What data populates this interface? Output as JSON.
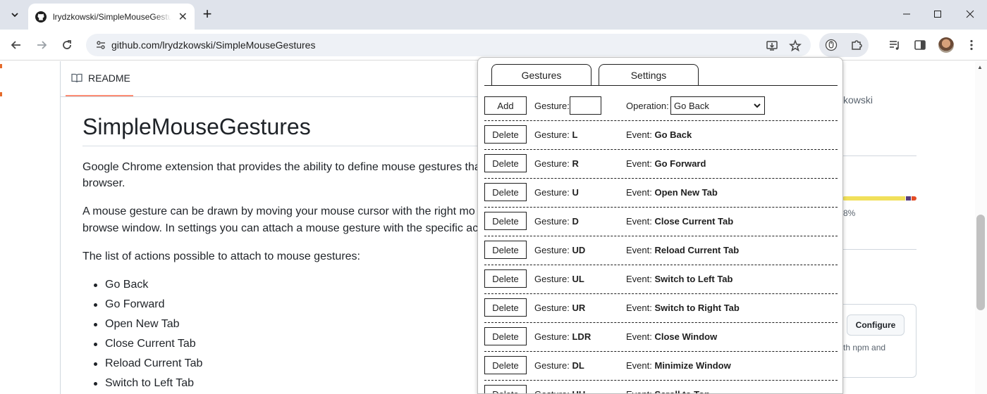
{
  "browser": {
    "tab_title": "lrydzkowski/SimpleMouseGestures",
    "url": "github.com/lrydzkowski/SimpleMouseGestures"
  },
  "readme": {
    "tab_label": "README",
    "title": "SimpleMouseGestures",
    "paragraphs": [
      "Google Chrome extension that provides the ability to define mouse gestures tha",
      "browser.",
      "A mouse gesture can be drawn by moving your mouse cursor with the right mo",
      "browse window. In settings you can attach a mouse gesture with the specific act",
      "The list of actions possible to attach to mouse gestures:"
    ],
    "actions": [
      "Go Back",
      "Go Forward",
      "Open New Tab",
      "Close Current Tab",
      "Reload Current Tab",
      "Switch to Left Tab"
    ]
  },
  "sidebar": {
    "owner_fragment": "kowski",
    "lang_percent_fragment": "8%",
    "config_button": "Configure",
    "config_text_fragment": "th npm and",
    "lang_colors": [
      "#f1e05a",
      "#563d7c",
      "#e34c26"
    ]
  },
  "popup": {
    "tabs": [
      "Gestures",
      "Settings"
    ],
    "add_label": "Add",
    "gesture_label": "Gesture:",
    "operation_label": "Operation:",
    "operation_selected": "Go Back",
    "event_label": "Event:",
    "delete_label": "Delete",
    "rows": [
      {
        "gesture": "L",
        "event": "Go Back"
      },
      {
        "gesture": "R",
        "event": "Go Forward"
      },
      {
        "gesture": "U",
        "event": "Open New Tab"
      },
      {
        "gesture": "D",
        "event": "Close Current Tab"
      },
      {
        "gesture": "UD",
        "event": "Reload Current Tab"
      },
      {
        "gesture": "UL",
        "event": "Switch to Left Tab"
      },
      {
        "gesture": "UR",
        "event": "Switch to Right Tab"
      },
      {
        "gesture": "LDR",
        "event": "Close Window"
      },
      {
        "gesture": "DL",
        "event": "Minimize Window"
      },
      {
        "gesture": "UU",
        "event": "Scroll to Top"
      }
    ]
  }
}
